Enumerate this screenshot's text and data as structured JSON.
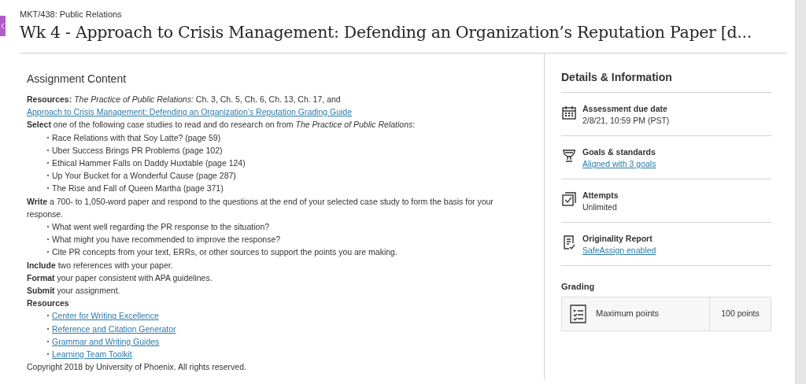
{
  "header": {
    "course": "MKT/438: Public Relations",
    "title": "Wk 4 - Approach to Crisis Management: Defending an Organization’s Reputation Paper [d..."
  },
  "content": {
    "heading": "Assignment Content",
    "blocks": [
      {
        "kind": "paragraph",
        "text": "**Resources:** *The Practice of Public Relations:* Ch. 3, Ch. 5, Ch. 6, Ch. 13, Ch. 17, and ",
        "link": "Approach to Crisis Management: Defending an Organization’s Reputation Grading Guide"
      },
      {
        "kind": "paragraph",
        "text": "**Select** one of the following case studies to read and do research on from *The Practice of Public Relations*:"
      },
      {
        "kind": "bullets",
        "items": [
          {
            "text": "Race Relations with that Soy Latte? (page 59)",
            "link": false
          },
          {
            "text": "Uber Success Brings PR Problems (page 102)",
            "link": false
          },
          {
            "text": "Ethical Hammer Falls on Daddy Huxtable (page 124)",
            "link": false
          },
          {
            "text": "Up Your Bucket for a Wonderful Cause (page 287)",
            "link": false
          },
          {
            "text": "The Rise and Fall of Queen Martha (page 371)",
            "link": false
          }
        ]
      },
      {
        "kind": "paragraph",
        "text": "**Write** a 700- to 1,050-word paper and respond to the questions at the end of your selected case study to form the basis for your response."
      },
      {
        "kind": "bullets",
        "items": [
          {
            "text": "What went well regarding the PR response to the situation?",
            "link": false
          },
          {
            "text": "What might you have recommended to improve the response?",
            "link": false
          },
          {
            "text": "Cite PR concepts from your text, ERRs, or other sources to support the points you are making.",
            "link": false
          }
        ]
      },
      {
        "kind": "paragraph",
        "text": "**Include** two references with your paper."
      },
      {
        "kind": "paragraph",
        "text": "**Format** your paper consistent with APA guidelines."
      },
      {
        "kind": "paragraph",
        "text": "**Submit** your assignment."
      },
      {
        "kind": "heading",
        "text": "Resources"
      },
      {
        "kind": "bullets",
        "items": [
          {
            "text": "Center for Writing Excellence",
            "link": true
          },
          {
            "text": "Reference and Citation Generator",
            "link": true
          },
          {
            "text": "Grammar and Writing Guides",
            "link": true
          },
          {
            "text": "Learning Team Toolkit",
            "link": true
          }
        ]
      },
      {
        "kind": "paragraph",
        "text": "Copyright 2018 by University of Phoenix. All rights reserved."
      }
    ]
  },
  "details": {
    "heading": "Details & Information",
    "items": [
      {
        "kind": "calendar",
        "label": "Assessment due date",
        "value": "2/8/21, 10:59 PM (PST)",
        "link": false
      },
      {
        "kind": "trophy",
        "label": "Goals & standards",
        "value": "Aligned with 3 goals",
        "link": true
      },
      {
        "kind": "attempts",
        "label": "Attempts",
        "value": "Unlimited",
        "link": false
      },
      {
        "kind": "report",
        "label": "Originality Report",
        "value": "SafeAssign enabled",
        "link": true
      }
    ]
  },
  "grading": {
    "heading": "Grading",
    "label": "Maximum points",
    "value": "100 points"
  }
}
